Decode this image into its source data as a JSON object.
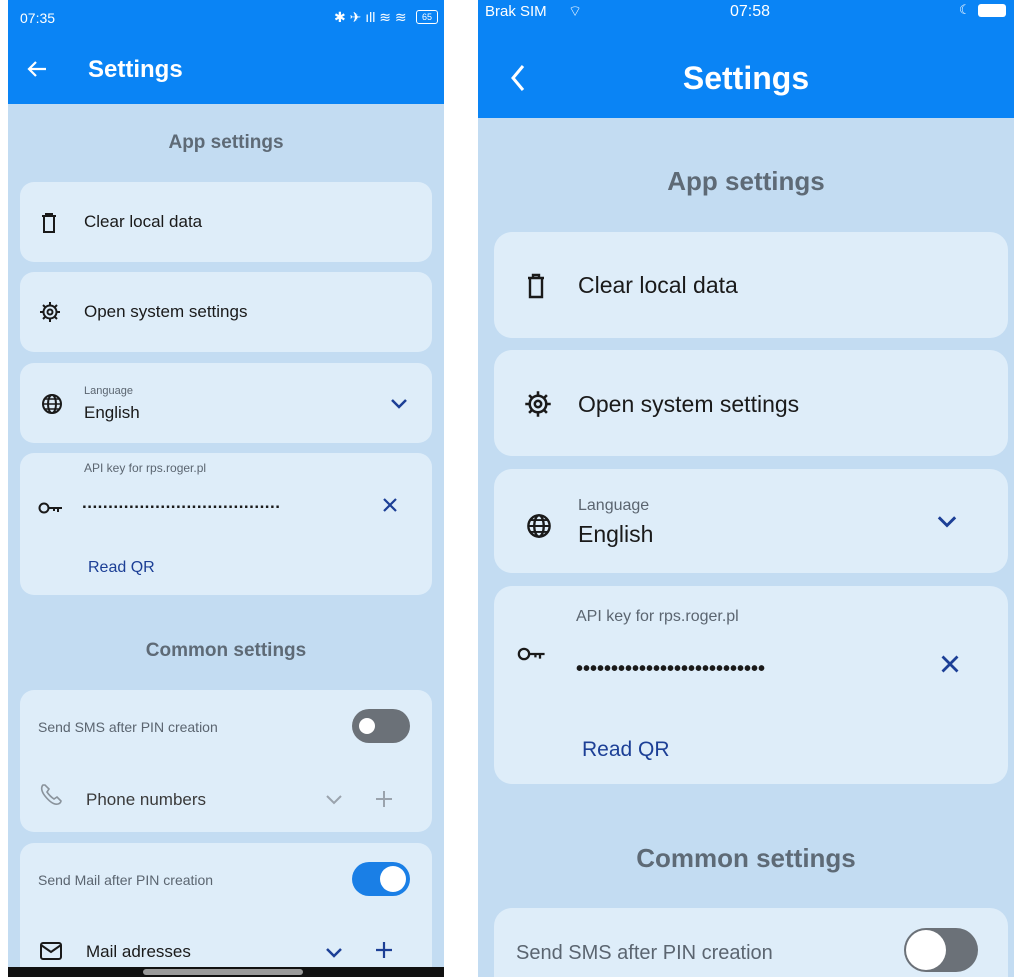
{
  "left": {
    "status": {
      "time": "07:35",
      "battery": "65"
    },
    "appbar_title": "Settings",
    "app_section": "App settings",
    "clear_local_data": "Clear local data",
    "open_system_settings": "Open system settings",
    "language": {
      "label": "Language",
      "value": "English"
    },
    "api_key": {
      "label": "API key for rps.roger.pl",
      "value": "......................................"
    },
    "read_qr": "Read QR",
    "common_section": "Common settings",
    "sms": {
      "label": "Send SMS after PIN creation",
      "enabled": false,
      "list_label": "Phone numbers"
    },
    "mail": {
      "label": "Send Mail after PIN creation",
      "enabled": true,
      "list_label": "Mail adresses"
    }
  },
  "right": {
    "status": {
      "carrier": "Brak SIM",
      "time": "07:58"
    },
    "appbar_title": "Settings",
    "app_section": "App settings",
    "clear_local_data": "Clear local data",
    "open_system_settings": "Open system settings",
    "language": {
      "label": "Language",
      "value": "English"
    },
    "api_key": {
      "label": "API key for rps.roger.pl",
      "value": "•••••••••••••••••••••••••••"
    },
    "read_qr": "Read QR",
    "common_section": "Common settings",
    "sms": {
      "label": "Send SMS after PIN creation",
      "enabled": false
    }
  },
  "colors": {
    "appbar": "#0a84f5",
    "background": "#c3dcf2",
    "card": "#deedf9",
    "accent_text": "#1c3f96",
    "toggle_on": "#1a7fe6",
    "toggle_off": "#6b7178"
  }
}
